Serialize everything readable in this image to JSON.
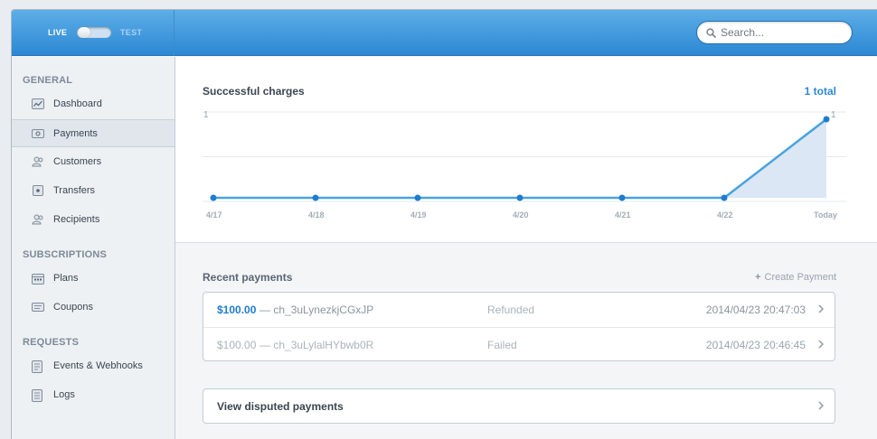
{
  "header": {
    "live_label": "LIVE",
    "test_label": "TEST",
    "search_placeholder": "Search..."
  },
  "sidebar": {
    "sections": [
      {
        "label": "GENERAL",
        "items": [
          "Dashboard",
          "Payments",
          "Customers",
          "Transfers",
          "Recipients"
        ]
      },
      {
        "label": "SUBSCRIPTIONS",
        "items": [
          "Plans",
          "Coupons"
        ]
      },
      {
        "label": "REQUESTS",
        "items": [
          "Events & Webhooks",
          "Logs"
        ]
      }
    ],
    "active_item": "Payments"
  },
  "chart_data": {
    "type": "area",
    "title": "Successful charges",
    "total_label": "1 total",
    "categories": [
      "4/17",
      "4/18",
      "4/19",
      "4/20",
      "4/21",
      "4/22",
      "Today"
    ],
    "values": [
      0,
      0,
      0,
      0,
      0,
      0,
      1
    ],
    "y_left_label": "1",
    "y_right_label": "1",
    "ylim": [
      0,
      1
    ],
    "line_color": "#4aa3df",
    "grid": true
  },
  "payments": {
    "title": "Recent payments",
    "create_label": "Create Payment",
    "rows": [
      {
        "amount": "$100.00",
        "separator": "—",
        "charge_id": "ch_3uLynezkjCGxJP",
        "status": "Refunded",
        "date": "2014/04/23 20:47:03"
      },
      {
        "amount": "$100.00",
        "separator": "—",
        "charge_id": "ch_3uLylalHYbwb0R",
        "status": "Failed",
        "date": "2014/04/23 20:46:45"
      }
    ]
  },
  "disputed": {
    "label": "View disputed payments"
  },
  "colors": {
    "accent": "#2f89d3",
    "header_top": "#5eaee8",
    "header_bottom": "#2c88d3"
  }
}
